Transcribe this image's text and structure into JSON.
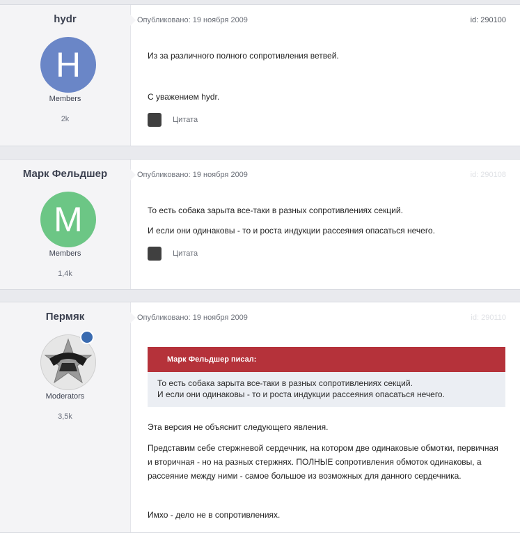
{
  "posts": [
    {
      "author": "hydr",
      "avatar_letter": "H",
      "avatar_color": "#6a86c7",
      "group": "Members",
      "count": "2k",
      "published": "Опубликовано: 19 ноября 2009",
      "id": "id: 290100",
      "paragraphs": [
        "Из за различного полного сопротивления ветвей.",
        "С уважением hydr."
      ],
      "quote_label": "Цитата"
    },
    {
      "author": "Марк Фельдшер",
      "avatar_letter": "M",
      "avatar_color": "#6cc685",
      "group": "Members",
      "count": "1,4k",
      "published": "Опубликовано: 19 ноября 2009",
      "id": "id: 290108",
      "paragraphs": [
        "То есть собака зарыта все-таки в разных сопротивлениях секций.",
        "И если они одинаковы - то и роста индукции рассеяния опасаться нечего."
      ],
      "quote_label": "Цитата"
    },
    {
      "author": "Пермяк",
      "group": "Moderators",
      "count": "3,5k",
      "published": "Опубликовано: 19 ноября 2009",
      "id": "id: 290110",
      "citation": {
        "header": "Марк Фельдшер писал:",
        "lines": [
          "То есть собака зарыта все-таки в разных сопротивлениях секций.",
          "И если они одинаковы - то и роста индукции рассеяния опасаться нечего."
        ]
      },
      "paragraphs": [
        "Эта версия не объяснит следующего явления.",
        "Представим себе стержневой сердечник, на котором две одинаковые обмотки, первичная",
        "и вторичная - но на разных стержнях. ПОЛНЫЕ сопротивления обмоток одинаковы, а",
        "рассеяние между ними - самое большое из возможных для данного сердечника.",
        "Имхо - дело не в сопротивлениях."
      ]
    }
  ]
}
